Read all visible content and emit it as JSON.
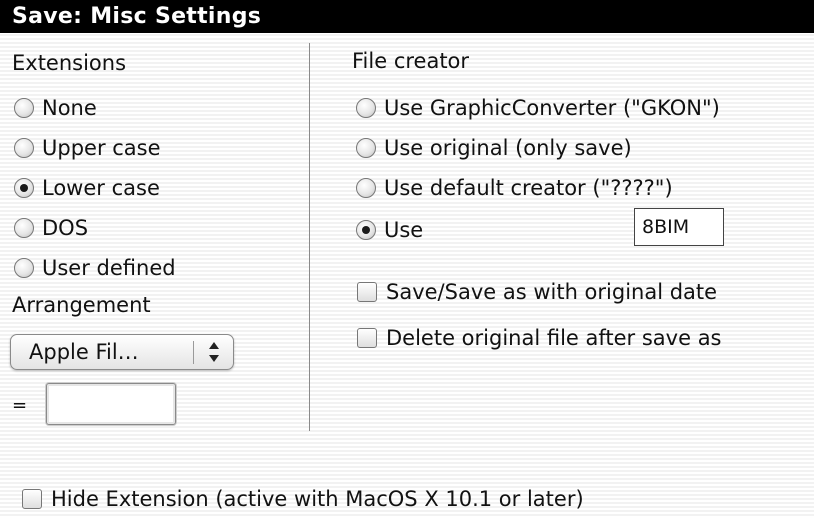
{
  "window": {
    "title": "Save: Misc Settings"
  },
  "extensions": {
    "heading": "Extensions",
    "options": [
      {
        "label": "None",
        "selected": false
      },
      {
        "label": "Upper case",
        "selected": false
      },
      {
        "label": "Lower case",
        "selected": true
      },
      {
        "label": "DOS",
        "selected": false
      },
      {
        "label": "User defined",
        "selected": false
      }
    ]
  },
  "arrangement": {
    "heading": "Arrangement",
    "selected_value": "Apple Fil…",
    "equals_label": "=",
    "field_value": ""
  },
  "file_creator": {
    "heading": "File creator",
    "options": [
      {
        "label": "Use GraphicConverter (\"GKON\")",
        "selected": false
      },
      {
        "label": "Use original (only save)",
        "selected": false
      },
      {
        "label": "Use default creator (\"????\")",
        "selected": false
      },
      {
        "label": "Use",
        "selected": true
      }
    ],
    "creator_code": "8BIM"
  },
  "checkboxes": {
    "original_date": {
      "label": "Save/Save as with original date",
      "checked": false
    },
    "delete_original": {
      "label": "Delete original file after save as",
      "checked": false
    },
    "hide_extension": {
      "label": "Hide Extension (active with MacOS X 10.1 or later)",
      "checked": false
    }
  }
}
